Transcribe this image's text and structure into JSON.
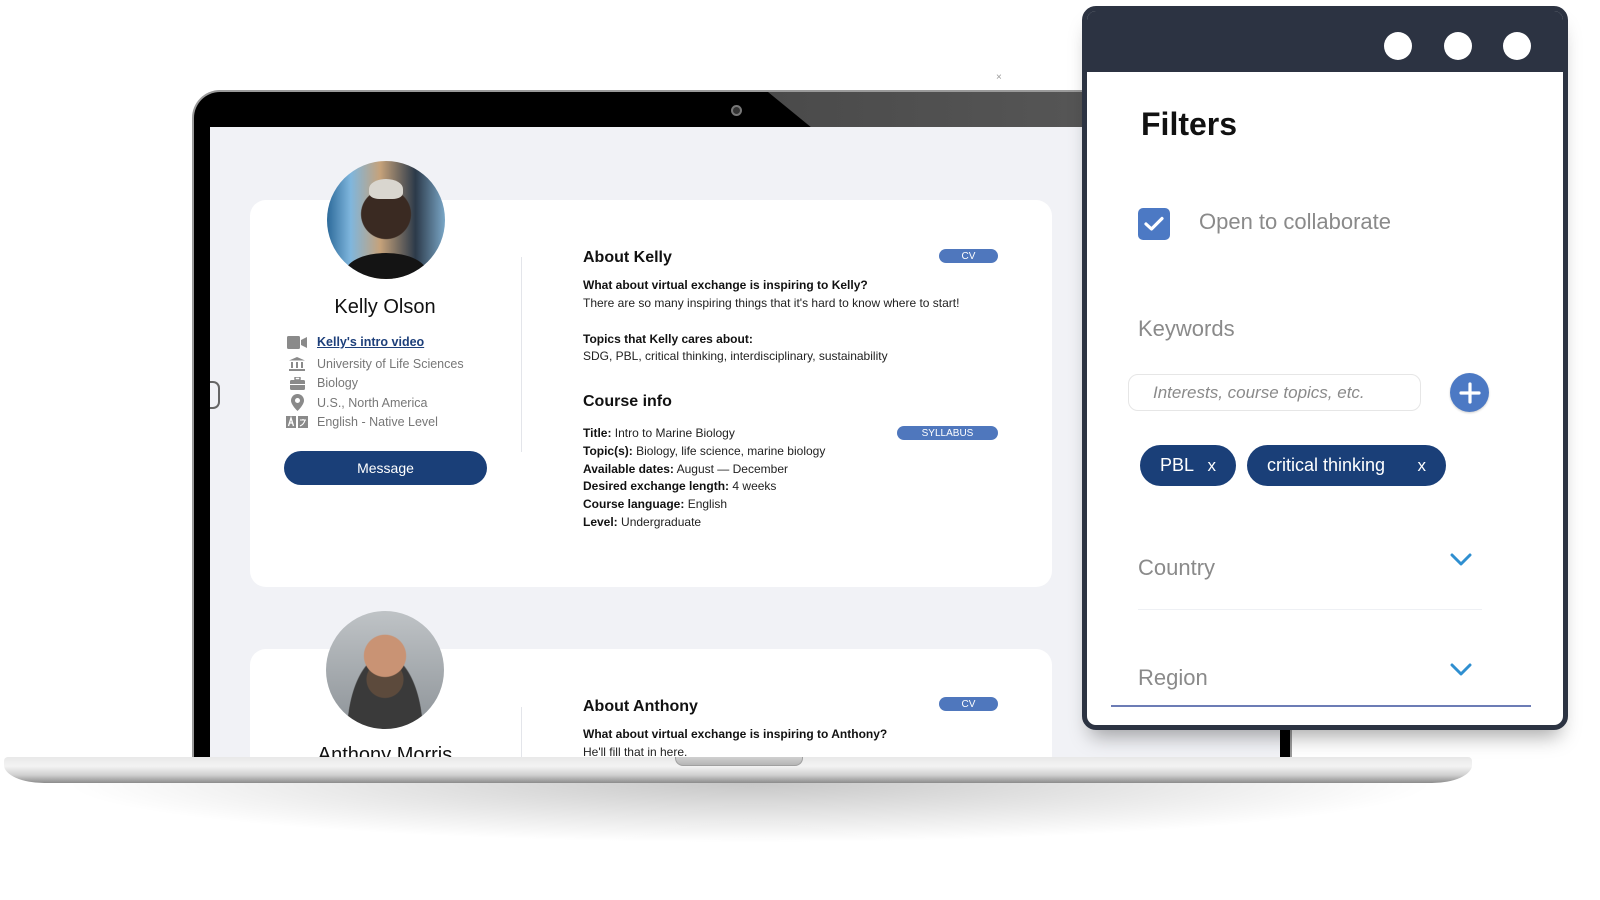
{
  "colors": {
    "primary_navy": "#1a3f78",
    "accent_blue": "#4c79c4",
    "pill_blue": "#4f77bd",
    "window_bar": "#2c3342",
    "chevron_blue": "#2f8fd0"
  },
  "profiles": [
    {
      "name": "Kelly Olson",
      "intro_video": "Kelly's intro video",
      "institution": "University of Life Sciences",
      "discipline": "Biology",
      "location": "U.S., North America",
      "language": "English - Native Level",
      "message_button": "Message",
      "about_title": "About Kelly",
      "cv_label": "CV",
      "inspiring_question": "What about virtual exchange is inspiring to Kelly?",
      "inspiring_answer": "There are so many inspiring things that it's hard to know where to start!",
      "topics_question": "Topics that Kelly cares about:",
      "topics_answer": "SDG, PBL, critical thinking, interdisciplinary, sustainability",
      "course_title": "Course info",
      "syllabus_label": "SYLLABUS",
      "course": {
        "title_key": "Title:",
        "title": "Intro to Marine Biology",
        "topics_key": "Topic(s):",
        "topics": "Biology, life science, marine biology",
        "dates_key": "Available dates:",
        "dates": "August — December",
        "length_key": "Desired exchange length:",
        "length": "4 weeks",
        "language_key": "Course language:",
        "language": "English",
        "level_key": "Level:",
        "level": "Undergraduate"
      }
    },
    {
      "name": "Anthony Morris",
      "about_title": "About Anthony",
      "cv_label": "CV",
      "inspiring_question": "What about virtual exchange is inspiring to Anthony?",
      "inspiring_answer": "He'll fill that in here."
    }
  ],
  "stray_mark": "×",
  "filters": {
    "title": "Filters",
    "open_to_collaborate": {
      "label": "Open to collaborate",
      "checked": true
    },
    "keywords": {
      "label": "Keywords",
      "placeholder": "Interests, course topics, etc.",
      "value": "",
      "chips": [
        {
          "label": "PBL",
          "remove": "x"
        },
        {
          "label": "critical thinking",
          "remove": "x"
        }
      ]
    },
    "country": {
      "label": "Country"
    },
    "region": {
      "label": "Region"
    }
  }
}
